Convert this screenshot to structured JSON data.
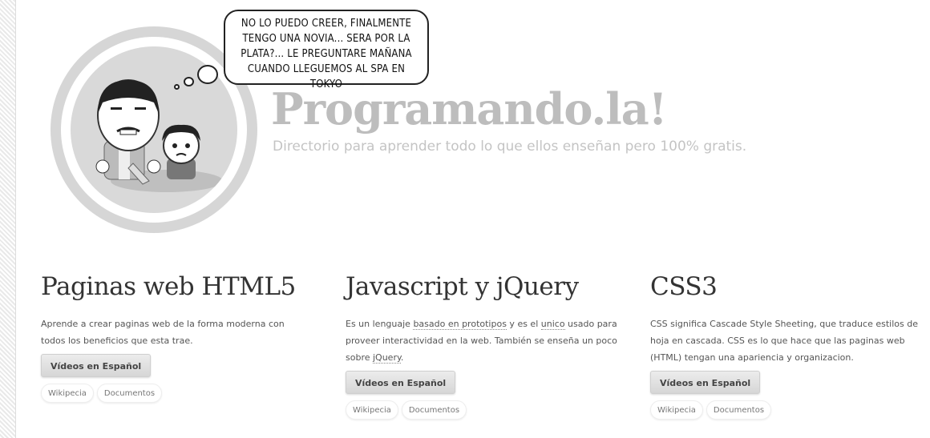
{
  "header": {
    "speech_bubble": [
      "NO LO PUEDO CREER, FINALMENTE",
      "TENGO UNA NOVIA... SERA POR LA",
      "PLATA?... LE PREGUNTARE MAÑANA",
      "CUANDO LLEGUEMOS AL SPA EN TOKYO"
    ],
    "title": "Programando.la!",
    "subtitle": "Directorio para aprender todo lo que ellos enseñan pero 100% gratis."
  },
  "sections": [
    {
      "heading": "Paginas web HTML5",
      "desc_parts": [
        "Aprende a crear paginas web de la forma moderna con todos los beneficios que esta trae."
      ],
      "button": "Vídeos en Español",
      "links": [
        "Wikipecia",
        "Documentos"
      ]
    },
    {
      "heading": "Javascript y jQuery",
      "desc_parts": [
        "Es un lenguaje ",
        "basado en prototipos",
        " y es el ",
        "unico",
        " usado para proveer interactividad en la web. También se enseña un poco sobre ",
        "jQuery",
        "."
      ],
      "button": "Vídeos en Español",
      "links": [
        "Wikipecia",
        "Documentos"
      ]
    },
    {
      "heading": "CSS3",
      "desc_parts": [
        "CSS significa Cascade Style Sheeting, que traduce estilos de hoja en cascada. CSS es lo que hace que las paginas web (HTML) tengan una apariencia y organizacion."
      ],
      "button": "Vídeos en Español",
      "links": [
        "Wikipecia",
        "Documentos"
      ]
    }
  ],
  "colors": {
    "title": "#bdbdbd",
    "subtitle": "#c4c4c4",
    "circle": "#d6d6d6"
  },
  "illustration": {
    "icon": "cartoon-couple-illustration"
  }
}
